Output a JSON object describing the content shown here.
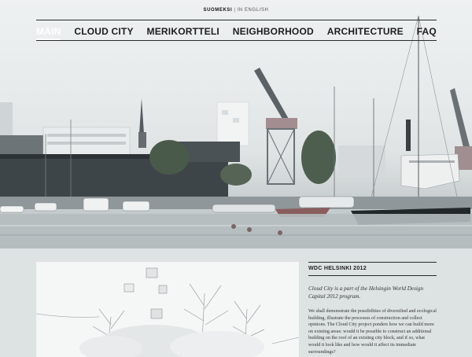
{
  "language": {
    "finnish": "SUOMEKSI",
    "separator": "|",
    "english": "IN ENGLISH"
  },
  "nav": {
    "items": [
      "MAIN",
      "CLOUD CITY",
      "MERIKORTTELI",
      "NEIGHBORHOOD",
      "ARCHITECTURE",
      "FAQ"
    ],
    "active": "MAIN"
  },
  "sidebar": {
    "heading": "WDC HELSINKI 2012",
    "intro": "Cloud City is a part of the Helsingin World Design Capital 2012 program.",
    "body": "We shall demonstrate the possibilities of diversified and ecological building, illustrate the processes of construction and collect opinions. The Cloud City project ponders how we can build more on existing areas: would it be possible to construct an additional building on the roof of an existing city block, and if so, what would it look like and how would it affect its immediate surroundings?"
  },
  "colors": {
    "background": "#dde2e2",
    "nav_text": "#1d1d1d",
    "nav_active": "#ffffff",
    "rule": "#2a2a2a"
  }
}
